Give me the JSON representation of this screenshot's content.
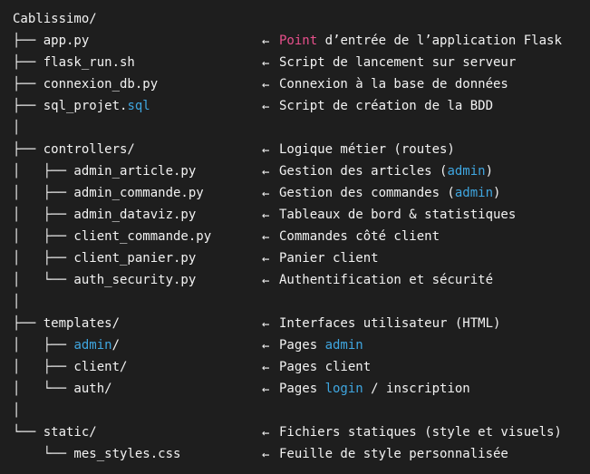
{
  "colors": {
    "background": "#1e1e1e",
    "text": "#f2f2f2",
    "keyword_blue": "#3fa6e0",
    "keyword_pink": "#e8508c"
  },
  "arrow_symbol": "←",
  "rows": [
    {
      "left": [
        {
          "t": "Cablissimo/"
        }
      ],
      "desc": []
    },
    {
      "left": [
        {
          "t": "├── app.py"
        }
      ],
      "desc": [
        {
          "t": "Point",
          "c": "pink"
        },
        {
          "t": " d’entrée de l’application Flask"
        }
      ]
    },
    {
      "left": [
        {
          "t": "├── flask_run.sh"
        }
      ],
      "desc": [
        {
          "t": "Script de lancement sur serveur"
        }
      ]
    },
    {
      "left": [
        {
          "t": "├── connexion_db.py"
        }
      ],
      "desc": [
        {
          "t": "Connexion à la base de données"
        }
      ]
    },
    {
      "left": [
        {
          "t": "├── sql_projet."
        },
        {
          "t": "sql",
          "c": "blue"
        }
      ],
      "desc": [
        {
          "t": "Script de création de la BDD"
        }
      ]
    },
    {
      "left": [
        {
          "t": "│"
        }
      ],
      "desc": []
    },
    {
      "left": [
        {
          "t": "├── controllers/"
        }
      ],
      "desc": [
        {
          "t": "Logique métier (routes)"
        }
      ]
    },
    {
      "left": [
        {
          "t": "│   ├── admin_article.py"
        }
      ],
      "desc": [
        {
          "t": "Gestion des articles ("
        },
        {
          "t": "admin",
          "c": "blue"
        },
        {
          "t": ")"
        }
      ]
    },
    {
      "left": [
        {
          "t": "│   ├── admin_commande.py"
        }
      ],
      "desc": [
        {
          "t": "Gestion des commandes ("
        },
        {
          "t": "admin",
          "c": "blue"
        },
        {
          "t": ")"
        }
      ]
    },
    {
      "left": [
        {
          "t": "│   ├── admin_dataviz.py"
        }
      ],
      "desc": [
        {
          "t": "Tableaux de bord & statistiques"
        }
      ]
    },
    {
      "left": [
        {
          "t": "│   ├── client_commande.py"
        }
      ],
      "desc": [
        {
          "t": "Commandes côté client"
        }
      ]
    },
    {
      "left": [
        {
          "t": "│   ├── client_panier.py"
        }
      ],
      "desc": [
        {
          "t": "Panier client"
        }
      ]
    },
    {
      "left": [
        {
          "t": "│   └── auth_security.py"
        }
      ],
      "desc": [
        {
          "t": "Authentification et sécurité"
        }
      ]
    },
    {
      "left": [
        {
          "t": "│"
        }
      ],
      "desc": []
    },
    {
      "left": [
        {
          "t": "├── templates/"
        }
      ],
      "desc": [
        {
          "t": "Interfaces utilisateur (HTML)"
        }
      ]
    },
    {
      "left": [
        {
          "t": "│   ├── "
        },
        {
          "t": "admin",
          "c": "blue"
        },
        {
          "t": "/"
        }
      ],
      "desc": [
        {
          "t": "Pages "
        },
        {
          "t": "admin",
          "c": "blue"
        }
      ]
    },
    {
      "left": [
        {
          "t": "│   ├── client/"
        }
      ],
      "desc": [
        {
          "t": "Pages client"
        }
      ]
    },
    {
      "left": [
        {
          "t": "│   └── auth/"
        }
      ],
      "desc": [
        {
          "t": "Pages "
        },
        {
          "t": "login",
          "c": "blue"
        },
        {
          "t": " / inscription"
        }
      ]
    },
    {
      "left": [
        {
          "t": "│"
        }
      ],
      "desc": []
    },
    {
      "left": [
        {
          "t": "└── static/"
        }
      ],
      "desc": [
        {
          "t": "Fichiers statiques (style et visuels)"
        }
      ]
    },
    {
      "left": [
        {
          "t": "    └── mes_styles.css"
        }
      ],
      "desc": [
        {
          "t": "Feuille de style personnalisée"
        }
      ]
    }
  ]
}
